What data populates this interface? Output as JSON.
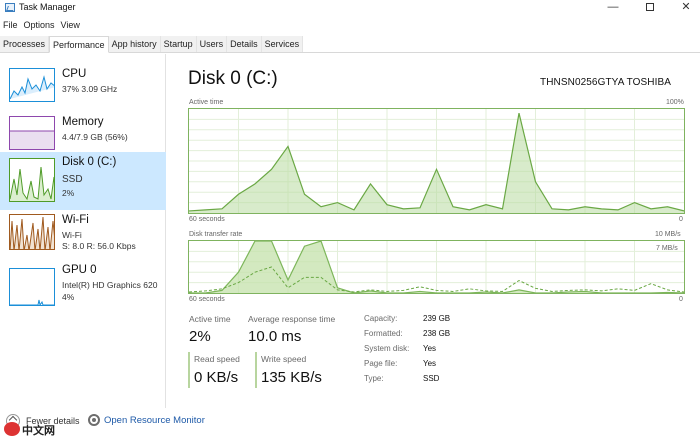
{
  "window": {
    "title": "Task Manager",
    "min_glyph": "—",
    "close_glyph": "✕"
  },
  "menu": [
    "File",
    "Options",
    "View"
  ],
  "tabs": [
    "Processes",
    "Performance",
    "App history",
    "Startup",
    "Users",
    "Details",
    "Services"
  ],
  "active_tab": "Performance",
  "sidebar": [
    {
      "name": "CPU",
      "sub1": "37%  3.09 GHz",
      "sub2": "",
      "color": "#1b8fd8",
      "selected": false
    },
    {
      "name": "Memory",
      "sub1": "4.4/7.9 GB (56%)",
      "sub2": "",
      "color": "#8e47ad",
      "selected": false
    },
    {
      "name": "Disk 0 (C:)",
      "sub1": "SSD",
      "sub2": "2%",
      "color": "#4f9b28",
      "selected": true
    },
    {
      "name": "Wi-Fi",
      "sub1": "Wi-Fi",
      "sub2": "S: 8.0  R: 56.0 Kbps",
      "color": "#a05a1f",
      "selected": false
    },
    {
      "name": "GPU 0",
      "sub1": "Intel(R) HD Graphics 620",
      "sub2": "4%",
      "color": "#1b8fd8",
      "selected": false
    }
  ],
  "main": {
    "title": "Disk 0 (C:)",
    "model": "THNSN0256GTYA TOSHIBA",
    "active_time_graph": {
      "label": "Active time",
      "max_label": "100%",
      "x_left": "60 seconds",
      "x_right": "0"
    },
    "transfer_graph": {
      "label": "Disk transfer rate",
      "max_label": "10 MB/s",
      "secondary_max": "7 MB/s",
      "x_left": "60 seconds",
      "x_right": "0"
    },
    "stats": {
      "active_time_label": "Active time",
      "active_time_value": "2%",
      "avg_response_label": "Average response time",
      "avg_response_value": "10.0 ms",
      "read_speed_label": "Read speed",
      "read_speed_value": "0 KB/s",
      "write_speed_label": "Write speed",
      "write_speed_value": "135 KB/s"
    },
    "info": [
      {
        "label": "Capacity:",
        "value": "239 GB"
      },
      {
        "label": "Formatted:",
        "value": "238 GB"
      },
      {
        "label": "System disk:",
        "value": "Yes"
      },
      {
        "label": "Page file:",
        "value": "Yes"
      },
      {
        "label": "Type:",
        "value": "SSD"
      }
    ]
  },
  "footer": {
    "fewer_details": "Fewer details",
    "open_resource_monitor": "Open Resource Monitor",
    "watermark": "中文网"
  },
  "chart_data": [
    {
      "type": "area",
      "title": "Active time",
      "x": [
        60,
        58,
        56,
        54,
        52,
        50,
        48,
        46,
        44,
        42,
        40,
        38,
        36,
        34,
        32,
        30,
        28,
        26,
        24,
        22,
        20,
        18,
        16,
        14,
        12,
        10,
        8,
        6,
        4,
        2,
        0
      ],
      "series": [
        {
          "values": [
            2,
            3,
            4,
            18,
            28,
            42,
            64,
            18,
            6,
            10,
            3,
            28,
            8,
            4,
            5,
            42,
            6,
            3,
            8,
            4,
            96,
            30,
            4,
            3,
            6,
            4,
            3,
            10,
            4,
            6,
            2
          ]
        }
      ],
      "ylim": [
        0,
        100
      ]
    },
    {
      "type": "area",
      "title": "Disk transfer rate",
      "series": [
        {
          "name": "Read speed",
          "values": [
            0,
            0,
            0.5,
            4,
            10,
            10,
            2.5,
            9,
            10,
            1,
            0,
            0.4,
            0,
            0,
            0.3,
            0,
            0,
            0,
            0.2,
            0,
            0.6,
            0,
            0,
            0.2,
            0.3,
            0,
            0,
            0,
            0,
            0.1,
            0
          ]
        },
        {
          "name": "Write speed",
          "values": [
            0.2,
            0.4,
            0.8,
            2,
            4,
            5,
            1,
            3,
            3,
            0.6,
            0.2,
            0.6,
            0.3,
            0.5,
            1.2,
            0.5,
            0.3,
            0.8,
            0.4,
            0.3,
            2.4,
            0.9,
            0.3,
            0.5,
            0.6,
            0.4,
            0.8,
            0.5,
            1.8,
            0.6,
            0.2
          ]
        }
      ],
      "ylim": [
        0,
        10
      ]
    }
  ]
}
